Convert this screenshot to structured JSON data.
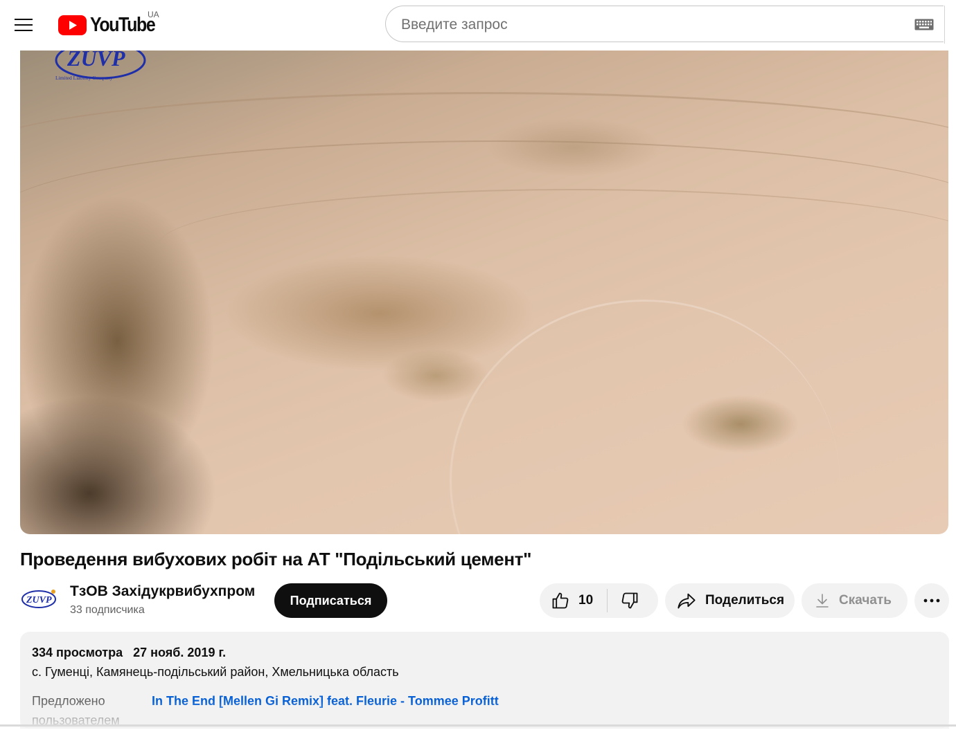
{
  "header": {
    "logo_text": "YouTube",
    "country_code": "UA",
    "search_placeholder": "Введите запрос",
    "search_value": ""
  },
  "video": {
    "watermark_logo_text": "ZUVP",
    "watermark_logo_subtext": "Limited Liability Company",
    "title": "Проведення вибухових робіт на АТ \"Подільський цемент\""
  },
  "channel": {
    "name": "ТзОВ Західукрвибухпром",
    "subscribers": "33 подписчика",
    "subscribe_label": "Подписаться"
  },
  "actions": {
    "like_count": "10",
    "share_label": "Поделиться",
    "download_label": "Скачать"
  },
  "description": {
    "views": "334 просмотра",
    "date": "27 нояб. 2019 г.",
    "location": "с. Гуменці, Камянець-подільський район, Хмельницька область",
    "suggested_label": "Предложено пользователем",
    "suggested_link": "In The End [Mellen Gi Remix] feat. Fleurie - Tommee Profitt"
  },
  "colors": {
    "brand_red": "#ff0000",
    "link_blue": "#065fd4",
    "logo_blue": "#1f2fa8"
  }
}
